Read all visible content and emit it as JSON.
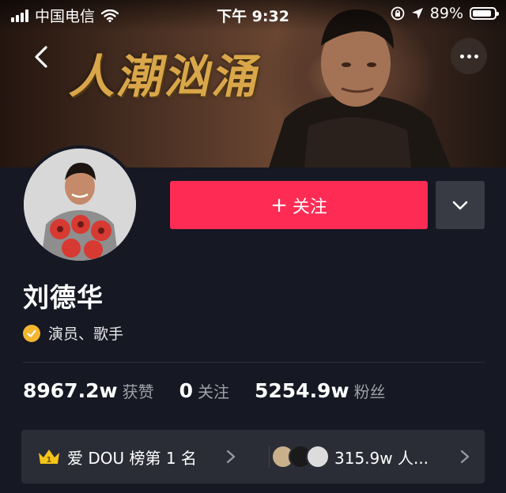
{
  "status_bar": {
    "carrier": "中国电信",
    "time": "下午 9:32",
    "battery": "89%",
    "battery_level": 0.89
  },
  "banner": {
    "title": "人潮汹涌"
  },
  "profile": {
    "name": "刘德华",
    "verification": "演员、歌手",
    "follow_label": "关注",
    "follow_plus": "+"
  },
  "stats": [
    {
      "value": "8967.2w",
      "label": "获赞"
    },
    {
      "value": "0",
      "label": "关注"
    },
    {
      "value": "5254.9w",
      "label": "粉丝"
    }
  ],
  "rank": {
    "rank_number": "1",
    "rank_text": "爱 DOU 榜第 1 名",
    "fans_text": "315.9w 人..."
  },
  "colors": {
    "background": "#161823",
    "follow_button": "#fe2c55",
    "dropdown_button": "#393b44",
    "verify_badge": "#f5b52f",
    "rank_bar": "#2b2d36"
  }
}
